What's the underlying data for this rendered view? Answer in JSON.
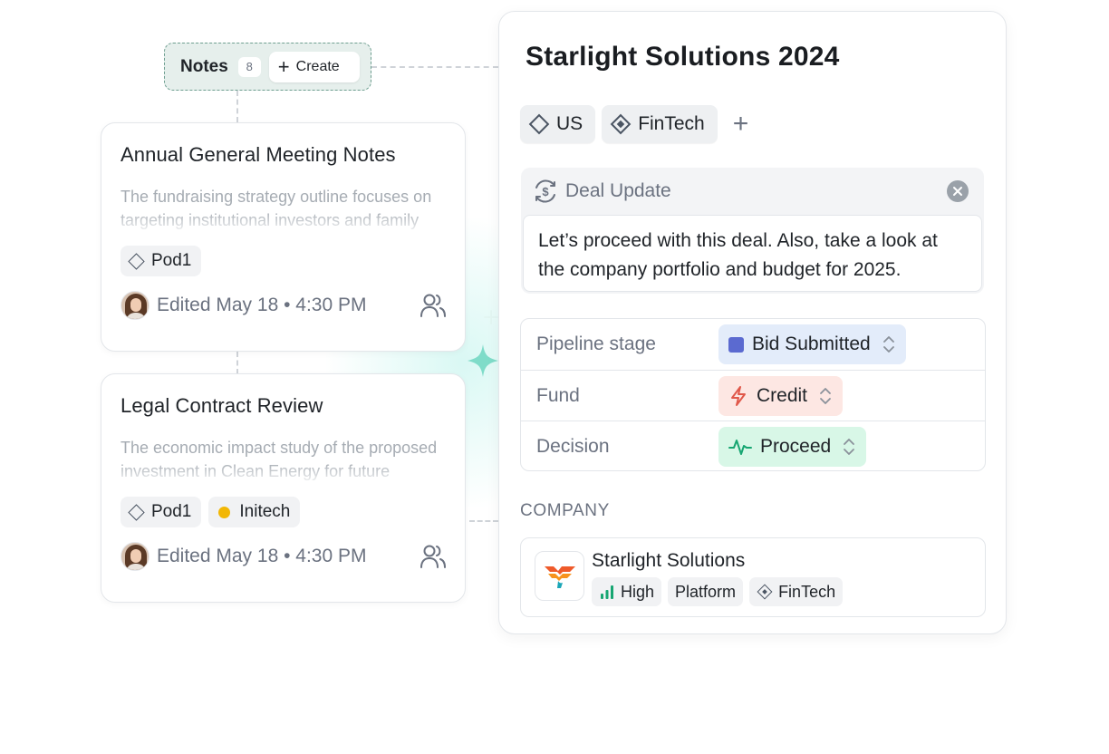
{
  "notes": {
    "title": "Notes",
    "count": "8",
    "create_label": "Create"
  },
  "note_cards": [
    {
      "title": "Annual General Meeting Notes",
      "excerpt": "The fundraising strategy outline focuses on targeting institutional investors and family offices for the upcoming",
      "tags": [
        "Pod1"
      ],
      "edited": "Edited May 18 • 4:30 PM"
    },
    {
      "title": "Legal Contract Review",
      "excerpt": "The economic impact study of the proposed investment in Clean Energy for future expansion and long term",
      "tags": [
        "Pod1",
        "Initech"
      ],
      "edited": "Edited May 18 • 4:30 PM"
    }
  ],
  "deal": {
    "title": "Starlight Solutions 2024",
    "chips": [
      "US",
      "FinTech"
    ],
    "update": {
      "label": "Deal Update",
      "body": "Let’s proceed with this deal. Also, take a look at the company portfolio and budget for 2025."
    },
    "properties": [
      {
        "label": "Pipeline stage",
        "value": "Bid Submitted"
      },
      {
        "label": "Fund",
        "value": "Credit"
      },
      {
        "label": "Decision",
        "value": "Proceed"
      }
    ],
    "company_section_label": "COMPANY",
    "company": {
      "name": "Starlight Solutions",
      "tags": [
        "High",
        "Platform",
        "FinTech"
      ]
    }
  },
  "colors": {
    "accent_teal": "#6e9e90",
    "bid_chip": "#e3ecfa",
    "credit_chip": "#fde7e3",
    "proceed_chip": "#d8f7e7",
    "initech_dot": "#f2b705"
  }
}
